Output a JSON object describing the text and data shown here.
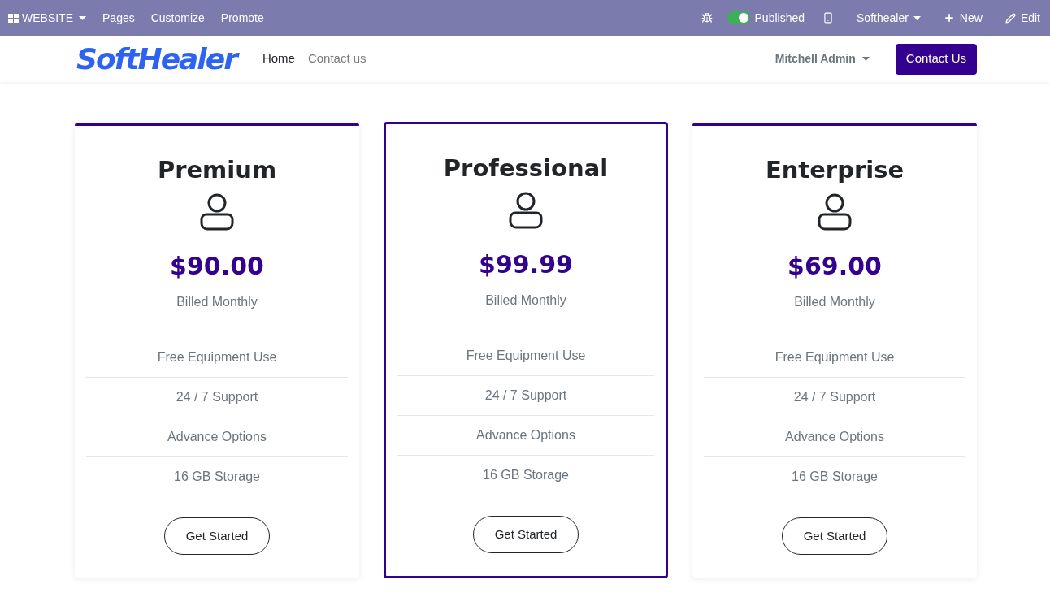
{
  "admin_bar": {
    "app_menu": "WEBSITE",
    "items": [
      "Pages",
      "Customize",
      "Promote"
    ],
    "published": {
      "label": "Published",
      "on": true
    },
    "website": "Softhealer",
    "new": "New",
    "edit": "Edit"
  },
  "navbar": {
    "logo": "SoftHealer",
    "links": [
      {
        "label": "Home",
        "selected": true
      },
      {
        "label": "Contact us",
        "selected": false
      }
    ],
    "user": "Mitchell Admin",
    "cta": "Contact Us"
  },
  "plans": [
    {
      "name": "Premium",
      "price": "$90.00",
      "billing": "Billed Monthly",
      "featured": false,
      "features": [
        "Free Equipment Use",
        "24 / 7 Support",
        "Advance Options",
        "16 GB Storage"
      ],
      "button": "Get Started"
    },
    {
      "name": "Professional",
      "price": "$99.99",
      "billing": "Billed Monthly",
      "featured": true,
      "features": [
        "Free Equipment Use",
        "24 / 7 Support",
        "Advance Options",
        "16 GB Storage"
      ],
      "button": "Get Started"
    },
    {
      "name": "Enterprise",
      "price": "$69.00",
      "billing": "Billed Monthly",
      "featured": false,
      "features": [
        "Free Equipment Use",
        "24 / 7 Support",
        "Advance Options",
        "16 GB Storage"
      ],
      "button": "Get Started"
    }
  ]
}
